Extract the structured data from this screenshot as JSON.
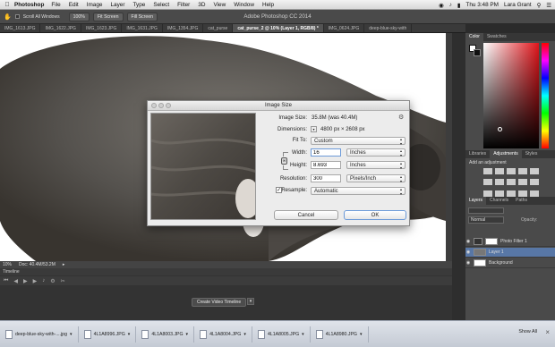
{
  "menubar": {
    "apple": "",
    "app": "Photoshop",
    "items": [
      "File",
      "Edit",
      "Image",
      "Layer",
      "Type",
      "Select",
      "Filter",
      "3D",
      "View",
      "Window",
      "Help"
    ],
    "clock": "Thu 3:48 PM",
    "user": "Lara Grant"
  },
  "options": {
    "scroll_all": "Scroll All Windows",
    "zoom": "100%",
    "fit_screen": "Fit Screen",
    "fill_screen": "Fill Screen"
  },
  "app_title": "Adobe Photoshop CC 2014",
  "tabs": [
    "IMG_1613.JPG",
    "IMG_1622.JPG",
    "IMG_1623.JPG",
    "IMG_1631.JPG",
    "IMG_1354.JPG",
    "cat_purse",
    "cat_purse_2 @ 10% (Layer 1, RGB/8) *",
    "IMG_0624.JPG",
    "deep-blue-sky-with"
  ],
  "status": {
    "zoom": "10%",
    "doc": "Doc: 40.4M/53.2M"
  },
  "timeline": {
    "title": "Timeline",
    "create_button": "Create Video Timeline"
  },
  "dialog": {
    "title": "Image Size",
    "image_size_label": "Image Size:",
    "image_size_value": "35.8M (was 40.4M)",
    "dimensions_label": "Dimensions:",
    "dimensions_value": "4800 px  ×  2608 px",
    "fit_to_label": "Fit To:",
    "fit_to_value": "Custom",
    "width_label": "Width:",
    "width_value": "16",
    "width_unit": "Inches",
    "height_label": "Height:",
    "height_value": "8.693",
    "height_unit": "Inches",
    "resolution_label": "Resolution:",
    "resolution_value": "300",
    "resolution_unit": "Pixels/Inch",
    "resample_label": "Resample:",
    "resample_value": "Automatic",
    "cancel": "Cancel",
    "ok": "OK"
  },
  "panels": {
    "color_tabs": [
      "Color",
      "Swatches"
    ],
    "adj_tabs": [
      "Libraries",
      "Adjustments",
      "Styles"
    ],
    "add_adjustment": "Add an adjustment",
    "layer_tabs": [
      "Layers",
      "Channels",
      "Paths"
    ],
    "kind_label": "Normal",
    "opacity_label": "Opacity:",
    "layers": [
      "Photo Filter 1",
      "Layer 1",
      "Background"
    ]
  },
  "downloads": {
    "items": [
      "deep-blue-sky-with-....jpg",
      "4L1A8996.JPG",
      "4L1A8003.JPG",
      "4L1A8004.JPG",
      "4L1A8005.JPG",
      "4L1A8980.JPG"
    ],
    "show_all": "Show All"
  }
}
